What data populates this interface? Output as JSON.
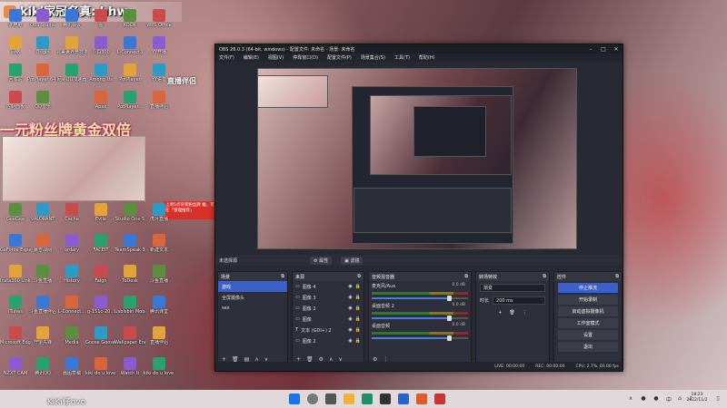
{
  "stream": {
    "title": "kiki家冠名真: hhw",
    "promo": "一元粉丝牌黄金双倍",
    "brand": "直播伴侣",
    "tip": "上周5点背景粉丝牌 推，可在「管理推荐」",
    "watermark": "KiKi仔ovo"
  },
  "desktop_icons": {
    "col1": [
      "此电脑",
      "网络",
      "回收站",
      "控制面板"
    ],
    "col1b": [
      "GeeGee",
      "GeForce Experience",
      "Insta360 Link Co...",
      "iTunes",
      "Microsoft Edge",
      "NZXT CAM"
    ],
    "col2": [
      "OBS Studio",
      "Origin",
      "PotPlayer 64 bit",
      "QQ音乐"
    ],
    "col2b": [
      "VALORANT",
      "暴雪战网",
      "斗鱼直播",
      "斗鱼直播伴侣",
      "守望先锋",
      "腾讯QQ"
    ],
    "col3": [
      "腾讯会议",
      "完美世界竞技平台",
      "网易UU加速器"
    ],
    "col3b": [
      "Cache",
      "ordary",
      "History",
      "L-Connect...",
      "Media",
      "画图草稿"
    ],
    "col4": [
      "图",
      "小白300",
      "Among Us",
      "Apex"
    ],
    "col4b": [
      "Evile",
      "FACEIT",
      "Faign",
      "g-151c-20...",
      "Goose Goose Duck",
      "kiki do u love me 2"
    ],
    "col5": [
      "KOOK",
      "L-Connect3",
      "PotPlayer",
      "PotPlayer..."
    ],
    "col5b": [
      "Studio One 5",
      "TeamSpeak 3",
      "ToDesk",
      "UsbIsbin Mobile Edit...",
      "Wallpaper Engine",
      "Watch It"
    ],
    "col6": [
      "WPS Office",
      "YY开播",
      "YY语音",
      "直播伴侣"
    ],
    "col6b": [
      "虎牙直播",
      "新建文本",
      "斗鱼直播",
      "腾讯课堂",
      "直播伴侣",
      "kiki do u love me 3"
    ]
  },
  "obs": {
    "title": "OBS 28.0.3 (64-bit, windows) - 配置文件: 未命名 - 场景: 未命名",
    "menu": [
      "文件(F)",
      "编辑(E)",
      "视图(V)",
      "停靠窗口(D)",
      "配置文件(P)",
      "场景集合(S)",
      "工具(T)",
      "帮助(H)"
    ],
    "no_source": "未选择源",
    "source_props": "属性",
    "source_filters": "滤镜",
    "scenes": {
      "title": "场景",
      "items": [
        "游戏",
        "全屏摄像头",
        "sex"
      ]
    },
    "sources": {
      "title": "来源",
      "items": [
        "图像 4",
        "图像 3",
        "图像 2",
        "图像",
        "文本 (GDI+) 2",
        "图像 2"
      ]
    },
    "mixer": {
      "title": "音频混音器",
      "channels": [
        {
          "name": "麦克风/Aux",
          "level": "0.0 dB"
        },
        {
          "name": "桌面音频 2",
          "level": "0.0 dB"
        },
        {
          "name": "桌面音频",
          "level": "0.0 dB"
        }
      ]
    },
    "transitions": {
      "title": "转场特效",
      "type": "渐变",
      "duration_label": "时长",
      "duration": "200 ms"
    },
    "controls": {
      "title": "控件",
      "buttons": [
        "停止推流",
        "开始录制",
        "启动虚拟摄像机",
        "工作室模式",
        "设置",
        "退出"
      ]
    },
    "status": {
      "live": "LIVE: 00:00:00",
      "rec": "REC: 00:00:00",
      "cpu": "CPU: 2.7%, 60.00 fps"
    }
  },
  "taskbar": {
    "clock_time": "18:23",
    "clock_date": "2022/11/2",
    "lang": "中"
  }
}
